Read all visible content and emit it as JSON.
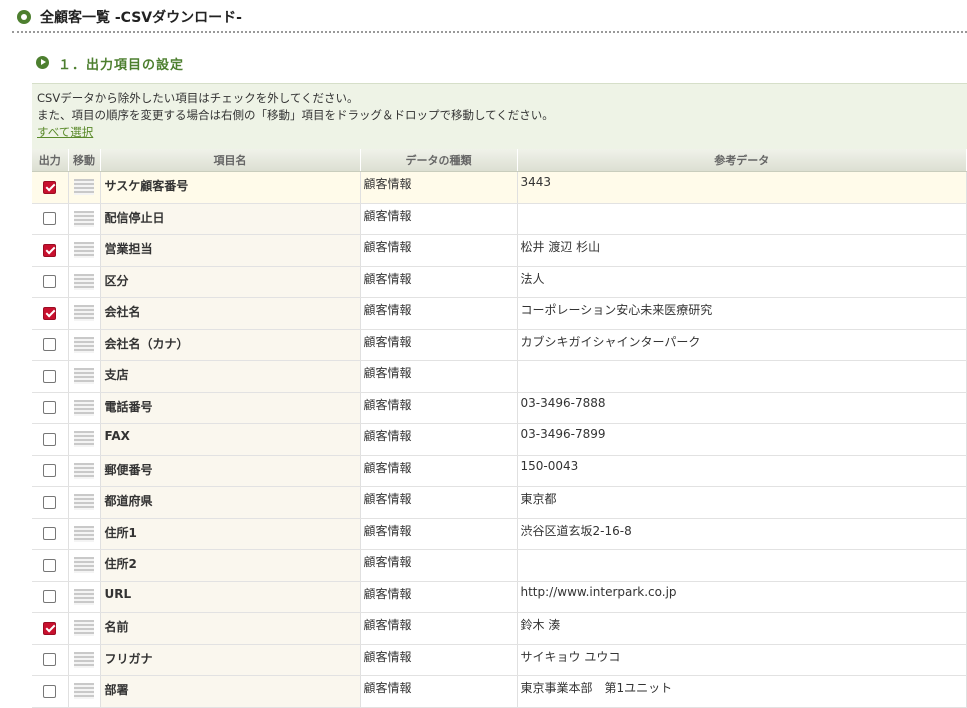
{
  "page": {
    "title": "全顧客一覧 -CSVダウンロード-"
  },
  "section": {
    "title": "１．出力項目の設定"
  },
  "info": {
    "line1": "CSVデータから除外したい項目はチェックを外してください。",
    "line2": "また、項目の順序を変更する場合は右側の「移動」項目をドラッグ＆ドロップで移動してください。",
    "select_all": "すべて選択"
  },
  "table": {
    "headers": {
      "output": "出力",
      "move": "移動",
      "item": "項目名",
      "type": "データの種類",
      "ref": "参考データ"
    },
    "rows": [
      {
        "checked": true,
        "name": "サスケ顧客番号",
        "type": "顧客情報",
        "ref": "3443"
      },
      {
        "checked": false,
        "name": "配信停止日",
        "type": "顧客情報",
        "ref": ""
      },
      {
        "checked": true,
        "name": "営業担当",
        "type": "顧客情報",
        "ref": "松井 渡辺 杉山"
      },
      {
        "checked": false,
        "name": "区分",
        "type": "顧客情報",
        "ref": "法人"
      },
      {
        "checked": true,
        "name": "会社名",
        "type": "顧客情報",
        "ref": "コーポレーション安心未来医療研究"
      },
      {
        "checked": false,
        "name": "会社名（カナ）",
        "type": "顧客情報",
        "ref": "カブシキガイシャインターパーク"
      },
      {
        "checked": false,
        "name": "支店",
        "type": "顧客情報",
        "ref": ""
      },
      {
        "checked": false,
        "name": "電話番号",
        "type": "顧客情報",
        "ref": "03-3496-7888"
      },
      {
        "checked": false,
        "name": "FAX",
        "type": "顧客情報",
        "ref": "03-3496-7899"
      },
      {
        "checked": false,
        "name": "郵便番号",
        "type": "顧客情報",
        "ref": "150-0043"
      },
      {
        "checked": false,
        "name": "都道府県",
        "type": "顧客情報",
        "ref": "東京都"
      },
      {
        "checked": false,
        "name": "住所1",
        "type": "顧客情報",
        "ref": "渋谷区道玄坂2-16-8"
      },
      {
        "checked": false,
        "name": "住所2",
        "type": "顧客情報",
        "ref": ""
      },
      {
        "checked": false,
        "name": "URL",
        "type": "顧客情報",
        "ref": "http://www.interpark.co.jp"
      },
      {
        "checked": true,
        "name": "名前",
        "type": "顧客情報",
        "ref": "鈴木 湊"
      },
      {
        "checked": false,
        "name": "フリガナ",
        "type": "顧客情報",
        "ref": "サイキョウ ユウコ"
      },
      {
        "checked": false,
        "name": "部署",
        "type": "顧客情報",
        "ref": "東京事業本部　第1ユニット"
      }
    ]
  }
}
